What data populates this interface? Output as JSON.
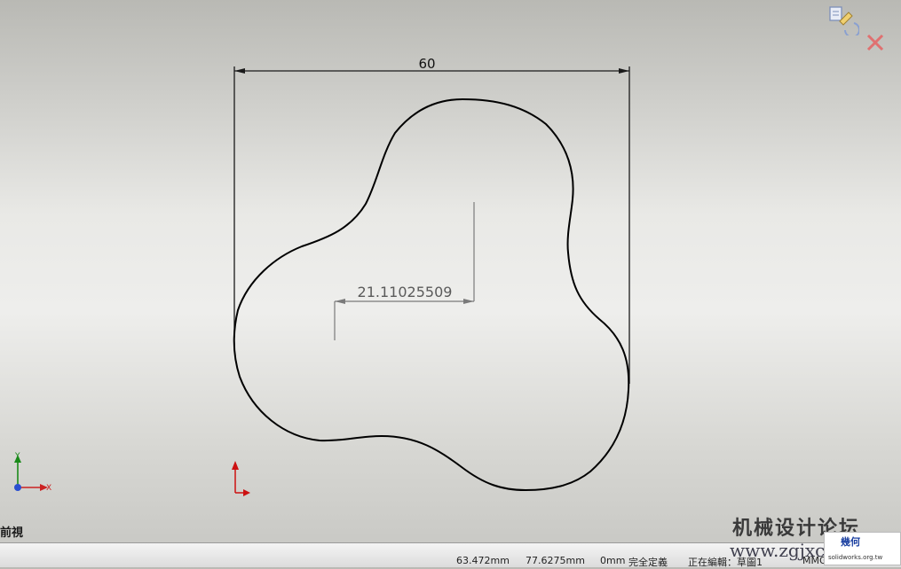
{
  "sketch": {
    "width_dimension": "60",
    "radius_dimension": "21.11025509"
  },
  "triad": {
    "y_label": "Y",
    "x_label": "X"
  },
  "view_name": "前視",
  "status_bar": {
    "x_coord": "63.472mm",
    "y_coord": "77.6275mm",
    "z_coord": "0mm",
    "sketch_state": "完全定義",
    "editing": "正在編輯：草圖1",
    "units": "MMGS"
  },
  "watermark": {
    "forum_name": "机械设计论坛",
    "url": "www.zgjxcad.com",
    "badge_title": "幾何",
    "badge_url": "solidworks.org.tw"
  },
  "icons": {
    "confirm": "confirm-corner-icon",
    "cancel": "cancel-x-icon"
  },
  "colors": {
    "dimension": "#5a5a5a",
    "sketch_line": "#000000",
    "triad_y": "#1a8a1a",
    "triad_x": "#cc2222",
    "origin": "#cc1111"
  }
}
